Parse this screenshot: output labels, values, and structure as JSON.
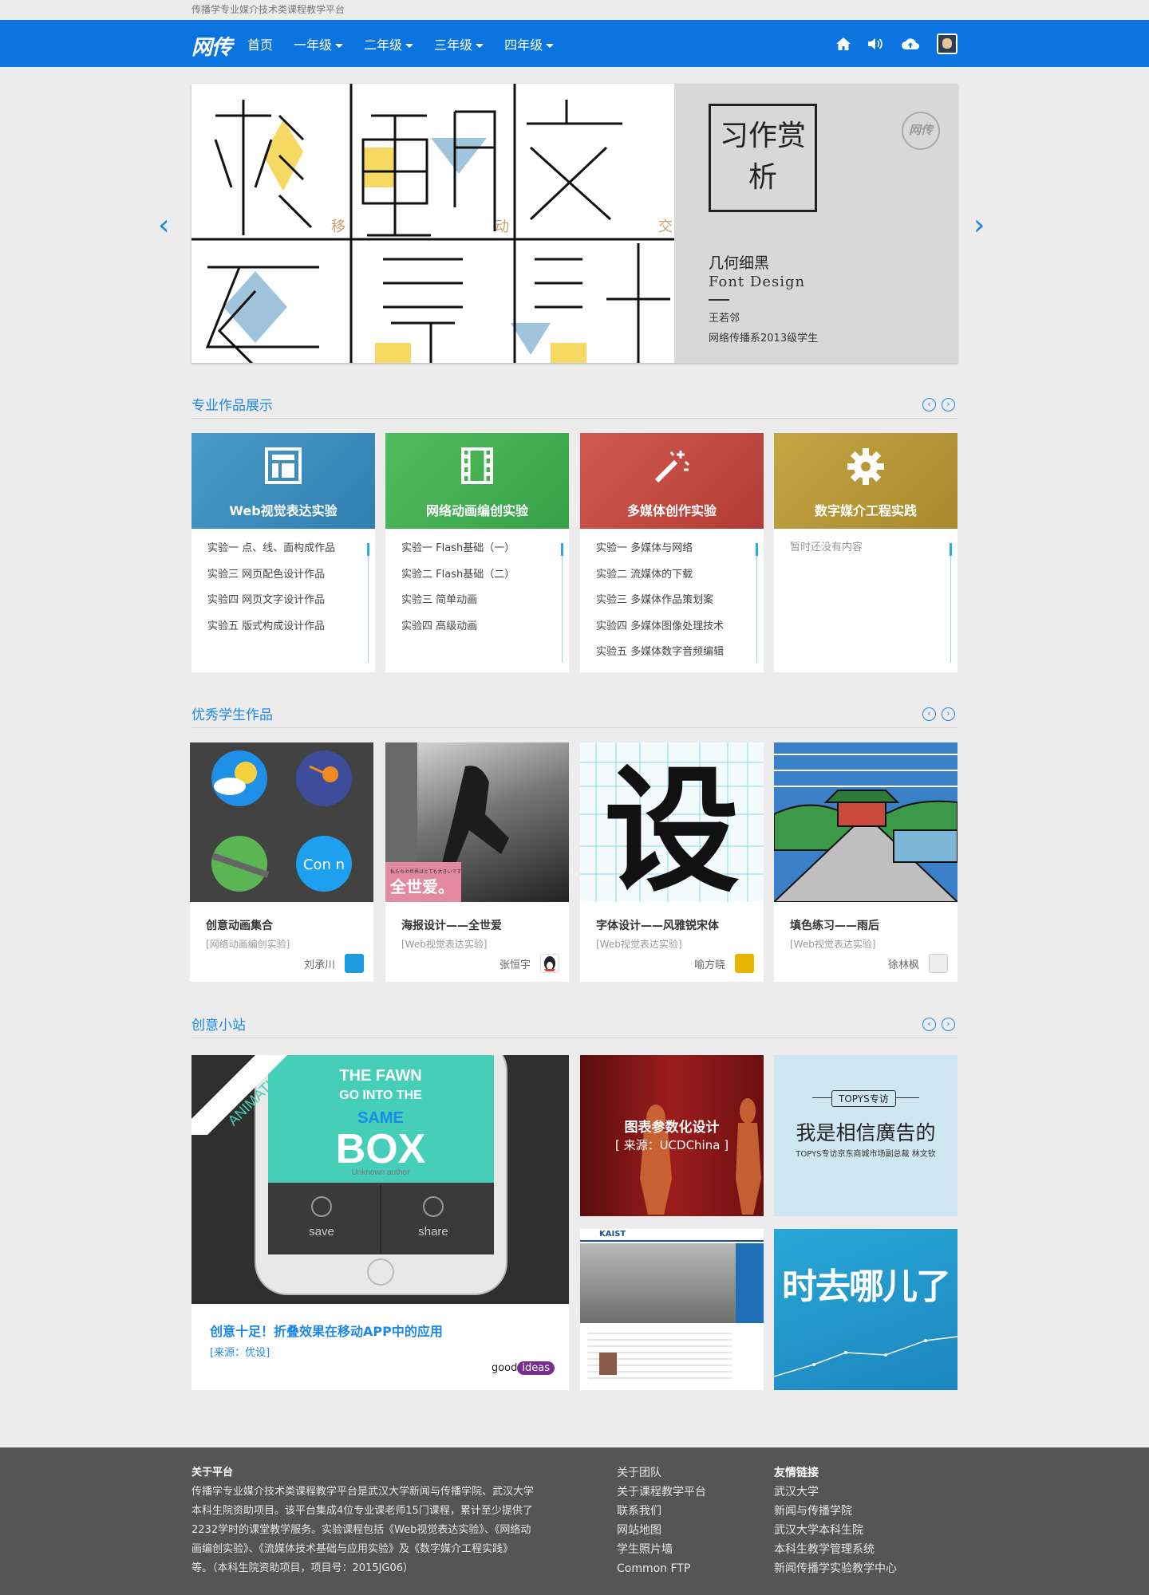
{
  "topbar": {
    "text": "传播学专业媒介技术类课程教学平台"
  },
  "nav": {
    "logo": "网传",
    "items": [
      {
        "label": "首页"
      },
      {
        "label": "一年级"
      },
      {
        "label": "二年级"
      },
      {
        "label": "三年级"
      },
      {
        "label": "四年级"
      }
    ]
  },
  "hero": {
    "art_glyphs": [
      "移",
      "動",
      "交",
      "互",
      "設",
      "計"
    ],
    "art_small": [
      "移",
      "动",
      "交"
    ],
    "caption_box": "习作赏析",
    "logo": "网传",
    "title": "几何细黑",
    "subtitle": "Font  Design",
    "author": "王若邻",
    "dept": "网络传播系2013级学生"
  },
  "sections": {
    "labs": "专业作品展示",
    "works": "优秀学生作品",
    "creative": "创意小站"
  },
  "labs": [
    {
      "title": "Web视觉表达实验",
      "color": "#3c8dbc",
      "items": [
        "实验一  点、线、面构成作品",
        "实验三  网页配色设计作品",
        "实验四  网页文字设计作品",
        "实验五  版式构成设计作品"
      ]
    },
    {
      "title": "网络动画编创实验",
      "color": "#3fae50",
      "items": [
        "实验一  Flash基础（一）",
        "实验二  Flash基础（二）",
        "实验三  简单动画",
        "实验四  高级动画"
      ]
    },
    {
      "title": "多媒体创作实验",
      "color": "#c0463f",
      "items": [
        "实验一  多媒体与网络",
        "实验二  流媒体的下载",
        "实验三  多媒体作品策划案",
        "实验四  多媒体图像处理技术",
        "实验五  多媒体数字音频编辑"
      ]
    },
    {
      "title": "数字媒介工程实践",
      "color": "#b89a35",
      "empty": "暂时还没有内容"
    }
  ],
  "works": [
    {
      "title": "创意动画集合",
      "category": "[网络动画编创实验]",
      "author": "刘承川",
      "avatar_color": "#1e9be0",
      "icon_text": "Con  n"
    },
    {
      "title": "海报设计——全世爱",
      "category": "[Web视觉表达实验]",
      "author": "张恒宇",
      "avatar_color": "#222",
      "poster_small": "私たちの世界はとても大きいです",
      "poster_text": "全世爱。"
    },
    {
      "title": "字体设计——风雅锐宋体",
      "category": "[Web视觉表达实验]",
      "author": "喻方晓",
      "avatar_color": "#e8b400",
      "glyph": "设"
    },
    {
      "title": "填色练习——雨后",
      "category": "[Web视觉表达实验]",
      "author": "徐林枫",
      "avatar_color": "#ddd"
    }
  ],
  "creative": {
    "main": {
      "ribbon": "ANIMATION",
      "phone_lines": [
        "THE FAWN",
        "GO INTO THE",
        "SAME",
        "BOX"
      ],
      "phone_author": "Unknown author",
      "btn_save": "save",
      "btn_share": "share",
      "title": "创意十足！折叠效果在移动APP中的应用",
      "source": "[来源：优设]",
      "brand_a": "good",
      "brand_b": "ideas"
    },
    "chart": {
      "title": "图表参数化设计",
      "source": "[ 来源：UCDChina ]"
    },
    "topys": {
      "tag": "TOPYS专访",
      "headline": "我是相信廣告的",
      "sub": "TOPYS专访京东商城市场副总裁 林文钦"
    },
    "kaist": {
      "logo": "KAIST"
    },
    "time": {
      "text": "时去哪儿了"
    }
  },
  "footer": {
    "about_title": "关于平台",
    "about_lines": [
      "传播学专业媒介技术类课程教学平台是武汉大学新闻与传播学院、武汉大学",
      "本科生院资助项目。该平台集成4位专业课老师15门课程，累计至少提供了",
      "2232学时的课堂教学服务。实验课程包括《Web视觉表达实验》、《网络动",
      "画编创实验》、《流媒体技术基础与应用实验》及《数字媒介工程实践》",
      "等。（本科生院资助项目，项目号：2015JG06）"
    ],
    "links1": [
      "关于团队",
      "关于课程教学平台",
      "联系我们",
      "网站地图",
      "学生照片墙",
      "Common FTP"
    ],
    "links2_title": "友情链接",
    "links2": [
      "武汉大学",
      "新闻与传播学院",
      "武汉大学本科生院",
      "本科生教学管理系统",
      "新闻传播学实验教学中心"
    ]
  }
}
